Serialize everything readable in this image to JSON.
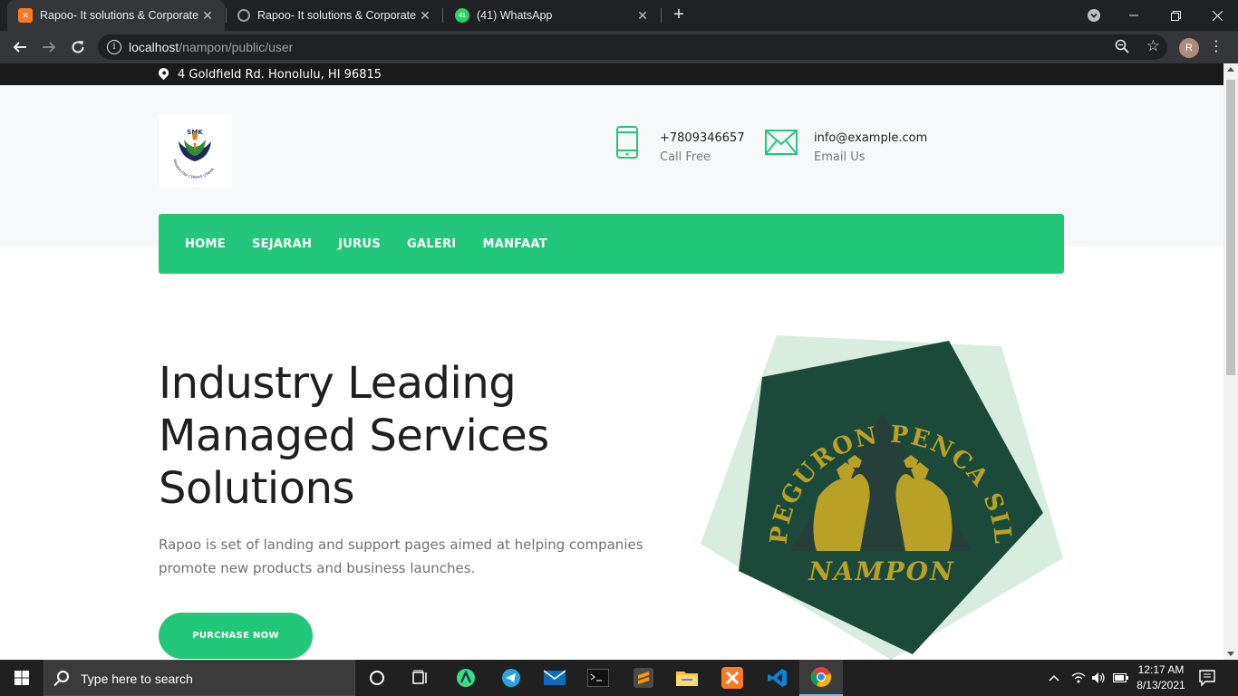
{
  "browser": {
    "tabs": [
      {
        "title": "Rapoo- It solutions & Corporate",
        "favicon": "xampp-icon",
        "active": true
      },
      {
        "title": "Rapoo- It solutions & Corporate",
        "favicon": "globe-icon",
        "active": false
      },
      {
        "title": "(41) WhatsApp",
        "favicon": "whatsapp-icon",
        "active": false
      }
    ],
    "whatsapp_badge": "41",
    "url_host": "localhost",
    "url_path": "/nampon/public/user",
    "profile_initial": "R"
  },
  "site": {
    "address": "4 Goldfield Rd. Honolulu, HI 96815",
    "logo": {
      "abbr": "SMK",
      "motto": "MAHAPUTRA CERDAS UTAMA"
    },
    "contacts": [
      {
        "value": "+7809346657",
        "label": "Call Free",
        "icon": "phone-icon"
      },
      {
        "value": "info@example.com",
        "label": "Email Us",
        "icon": "envelope-icon"
      }
    ],
    "nav": [
      "HOME",
      "SEJARAH",
      "JURUS",
      "GALERI",
      "MANFAAT"
    ],
    "hero": {
      "title": "Industry Leading Managed Services Solutions",
      "description": "Rapoo is set of landing and support pages aimed at helping companies promote new products and business launches.",
      "cta": "PURCHASE NOW",
      "art_text_top": "PEGURON PENCA SILAT",
      "art_text_bottom": "NAMPON"
    },
    "accent_color": "#23c77a"
  },
  "taskbar": {
    "search_placeholder": "Type here to search",
    "time": "12:17 AM",
    "date": "8/13/2021"
  }
}
